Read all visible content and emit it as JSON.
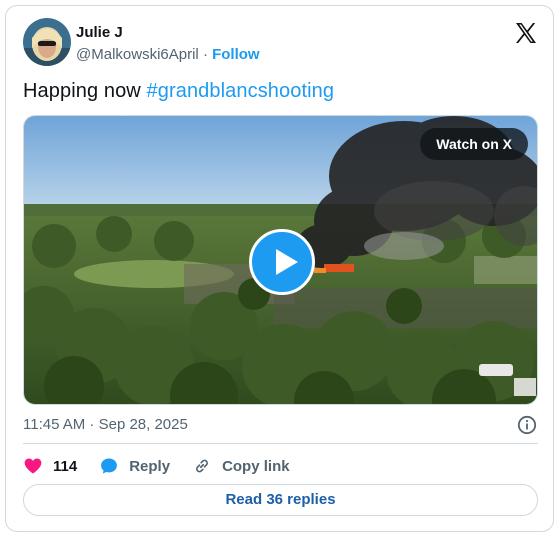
{
  "author": {
    "name": "Julie J",
    "handle": "@Malkowski6April",
    "separator": "·",
    "follow_label": "Follow"
  },
  "tweet": {
    "text": "Happing now ",
    "hashtag": "#grandblancshooting"
  },
  "media": {
    "watch_label": "Watch on X"
  },
  "timestamp": "11:45 AM · Sep 28, 2025",
  "actions": {
    "like_count": "114",
    "reply_label": "Reply",
    "copy_link_label": "Copy link"
  },
  "read_replies_label": "Read 36 replies",
  "colors": {
    "accent": "#1d9bf0",
    "like": "#f91880",
    "text_secondary": "#536471",
    "border": "#cfd9de"
  },
  "icons": [
    "x-logo-icon",
    "play-icon",
    "info-icon",
    "heart-icon",
    "reply-bubble-icon",
    "link-icon"
  ]
}
